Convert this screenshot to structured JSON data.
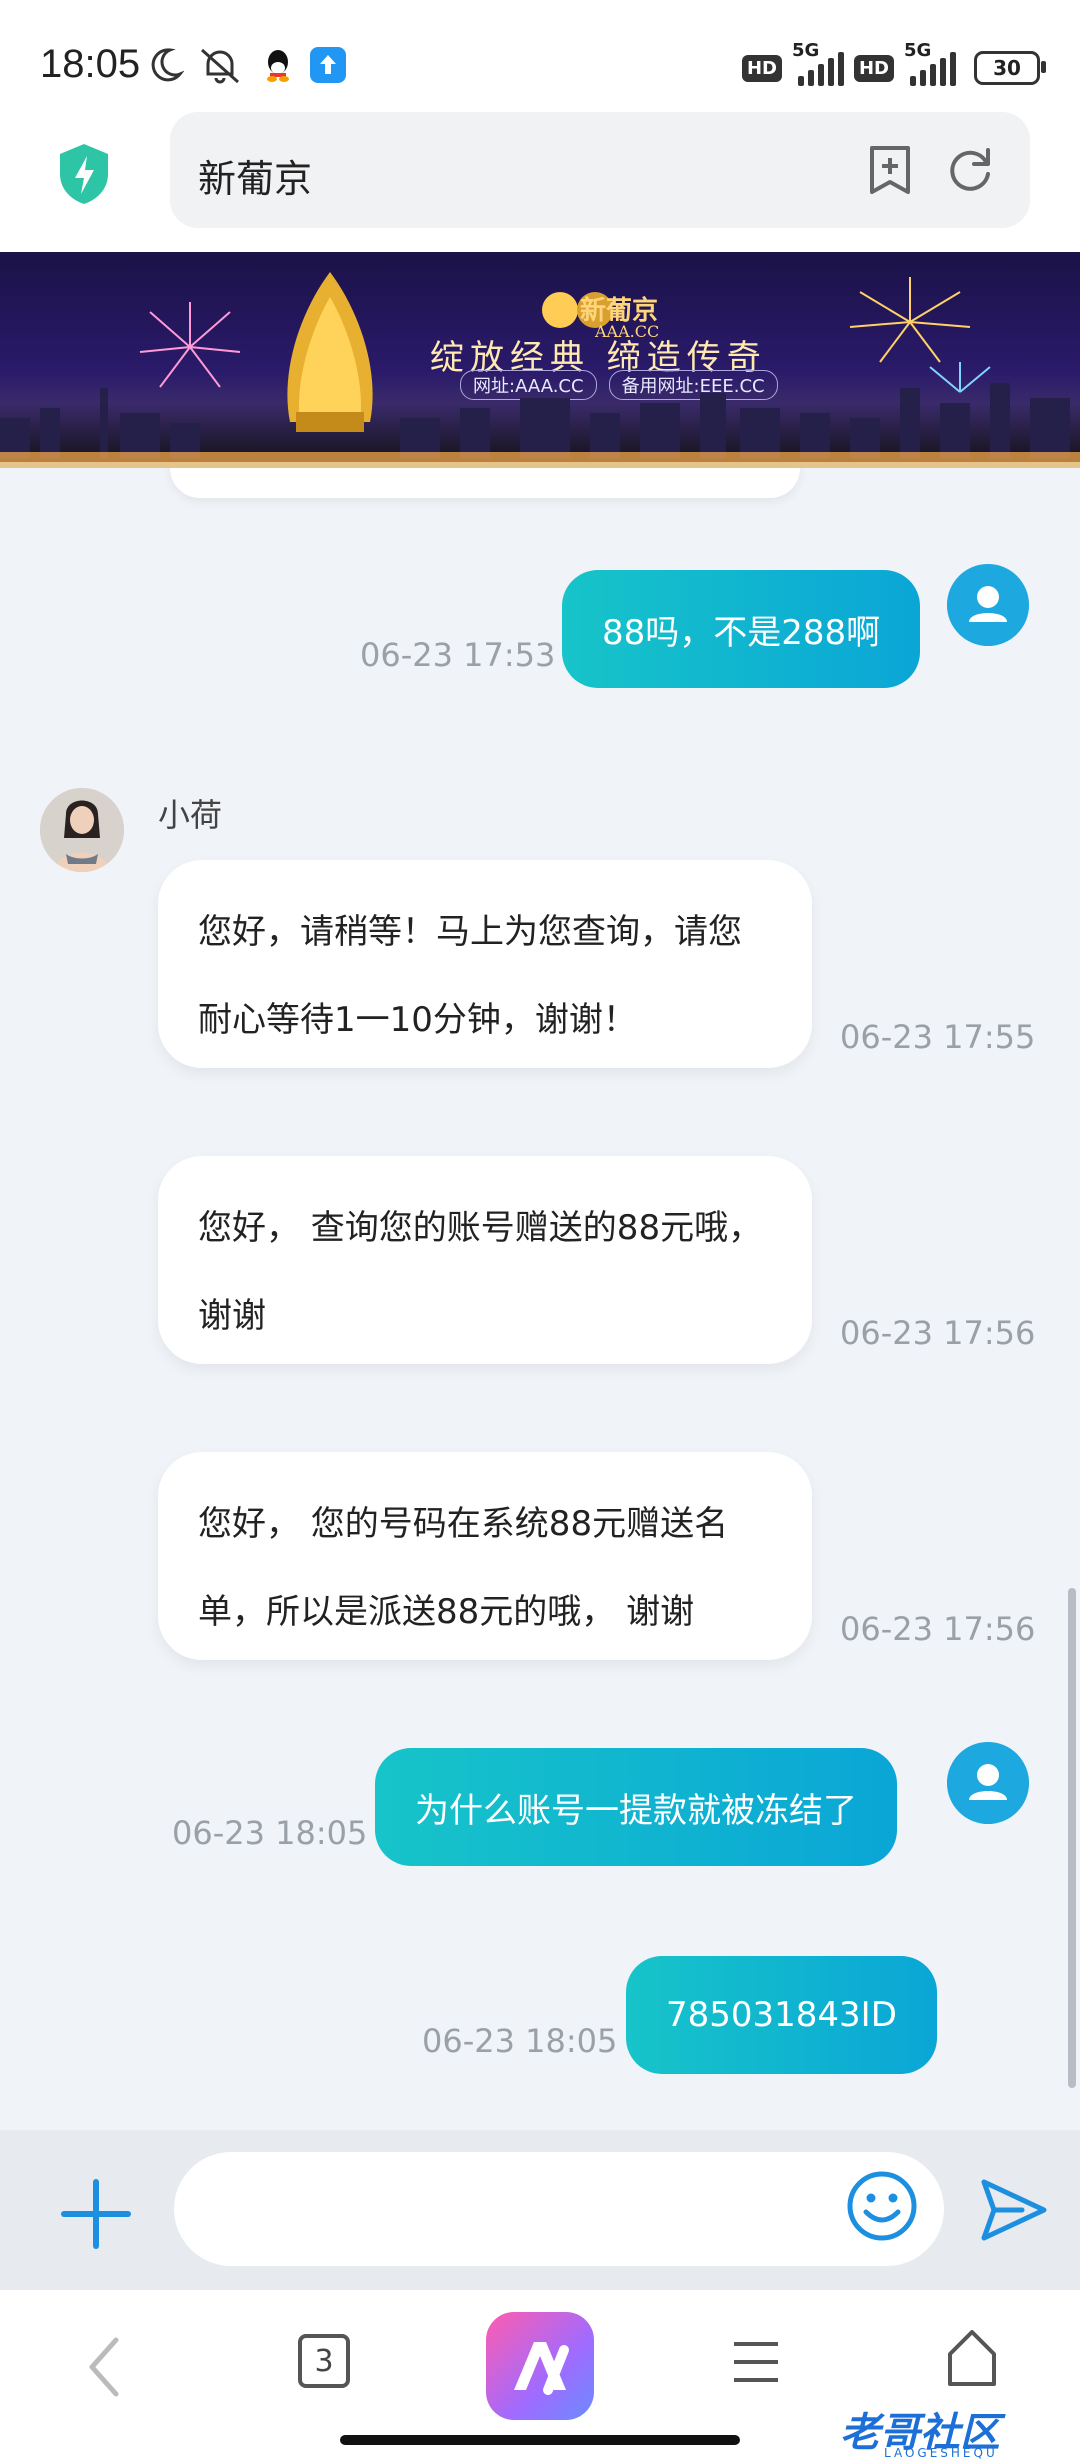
{
  "status_bar": {
    "time": "18:05",
    "network_1": "5G",
    "network_2": "5G",
    "hd_badge": "HD",
    "battery": "30"
  },
  "browser": {
    "url_text": "新葡京",
    "tab_count": "3"
  },
  "banner": {
    "brand": "新葡京",
    "brand_sub": "AAA.CC",
    "slogan": "绽放经典 缔造传奇",
    "url_primary": "网址:AAA.CC",
    "url_backup": "备用网址:EEE.CC"
  },
  "chat": {
    "agent_name": "小荷",
    "messages": [
      {
        "from": "user",
        "text": "88吗，不是288啊",
        "time": "06-23 17:53"
      },
      {
        "from": "agent",
        "text": "您好，请稍等！马上为您查询，请您耐心等待1一10分钟，谢谢！",
        "time": "06-23 17:55"
      },
      {
        "from": "agent",
        "text": "您好， 查询您的账号赠送的88元哦， 谢谢",
        "time": "06-23 17:56"
      },
      {
        "from": "agent",
        "text": "您好， 您的号码在系统88元赠送名单，所以是派送88元的哦， 谢谢",
        "time": "06-23 17:56"
      },
      {
        "from": "user",
        "text": "为什么账号一提款就被冻结了",
        "time": "06-23 18:05"
      },
      {
        "from": "user",
        "text": "785031843ID",
        "time": "06-23 18:05"
      }
    ]
  },
  "input": {
    "placeholder": ""
  },
  "watermark": {
    "text": "老哥社区",
    "sub": "LAOGESHEQU"
  },
  "colors": {
    "sent_bubble": "#10b6d2",
    "avatar_user": "#1ea8e0",
    "accent": "#1d8fe0"
  }
}
